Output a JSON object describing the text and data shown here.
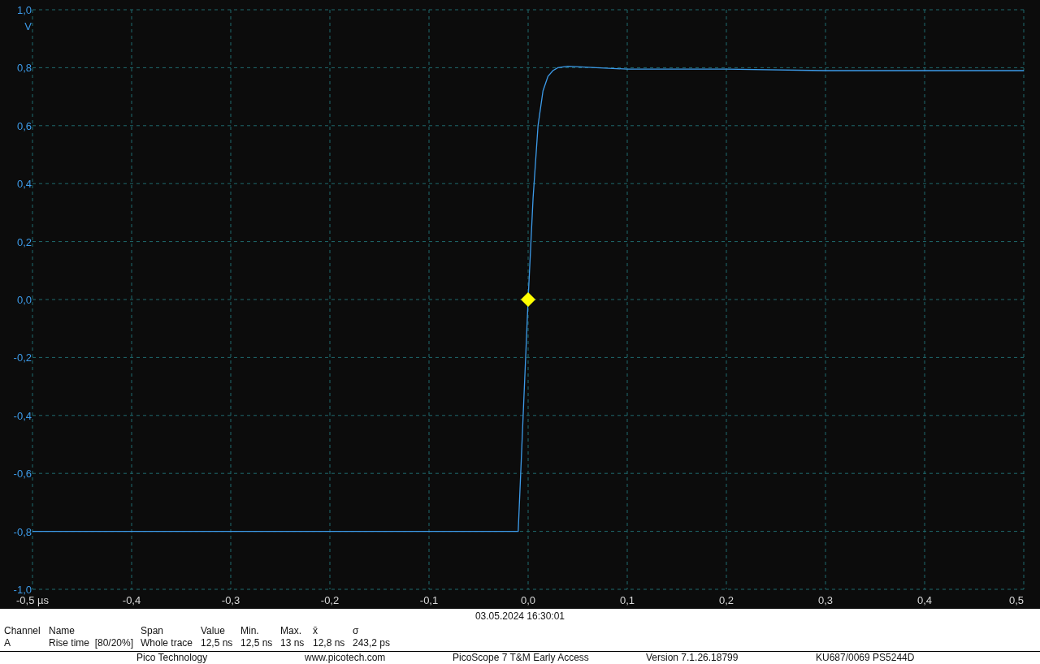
{
  "scope": {
    "chart_data": {
      "type": "line",
      "ylabel": "V",
      "grid": true,
      "xlim": [
        -0.5,
        0.5
      ],
      "ylim": [
        -1.0,
        1.0
      ],
      "xticks": [
        {
          "value": -0.5,
          "label": "-0,5 µs"
        },
        {
          "value": -0.4,
          "label": "-0,4"
        },
        {
          "value": -0.3,
          "label": "-0,3"
        },
        {
          "value": -0.2,
          "label": "-0,2"
        },
        {
          "value": -0.1,
          "label": "-0,1"
        },
        {
          "value": 0.0,
          "label": "0,0"
        },
        {
          "value": 0.1,
          "label": "0,1"
        },
        {
          "value": 0.2,
          "label": "0,2"
        },
        {
          "value": 0.3,
          "label": "0,3"
        },
        {
          "value": 0.4,
          "label": "0,4"
        },
        {
          "value": 0.5,
          "label": "0,5"
        }
      ],
      "yticks": [
        {
          "value": 1.0,
          "label": "1,0"
        },
        {
          "value": 0.8,
          "label": "0,8"
        },
        {
          "value": 0.6,
          "label": "0,6"
        },
        {
          "value": 0.4,
          "label": "0,4"
        },
        {
          "value": 0.2,
          "label": "0,2"
        },
        {
          "value": 0.0,
          "label": "0,0"
        },
        {
          "value": -0.2,
          "label": "-0,2"
        },
        {
          "value": -0.4,
          "label": "-0,4"
        },
        {
          "value": -0.6,
          "label": "-0,6"
        },
        {
          "value": -0.8,
          "label": "-0,8"
        },
        {
          "value": -1.0,
          "label": "-1,0"
        }
      ],
      "x": [
        -0.5,
        -0.3,
        -0.1,
        -0.01,
        -0.005,
        0.0,
        0.005,
        0.01,
        0.015,
        0.02,
        0.025,
        0.03,
        0.04,
        0.1,
        0.2,
        0.3,
        0.4,
        0.5
      ],
      "series": [
        {
          "color": "#3d9be9",
          "values": [
            -0.8,
            -0.8,
            -0.8,
            -0.8,
            -0.4,
            0.0,
            0.35,
            0.6,
            0.72,
            0.77,
            0.79,
            0.8,
            0.805,
            0.795,
            0.795,
            0.79,
            0.79,
            0.79
          ]
        }
      ]
    }
  },
  "timestamp": "03.05.2024 16:30:01",
  "measurements": {
    "columns": [
      "Channel",
      "Name",
      "Span",
      "Value",
      "Min.",
      "Max.",
      "x̄",
      "σ"
    ],
    "rows": [
      [
        "A",
        "Rise time  [80/20%]",
        "Whole trace",
        "12,5 ns",
        "12,5 ns",
        "13 ns",
        "12,8 ns",
        "243,2 ps"
      ]
    ]
  },
  "footer": [
    "Pico Technology",
    "www.picotech.com",
    "PicoScope 7 T&M Early Access",
    "Version 7.1.26.18799",
    "KU687/0069 PS5244D"
  ]
}
